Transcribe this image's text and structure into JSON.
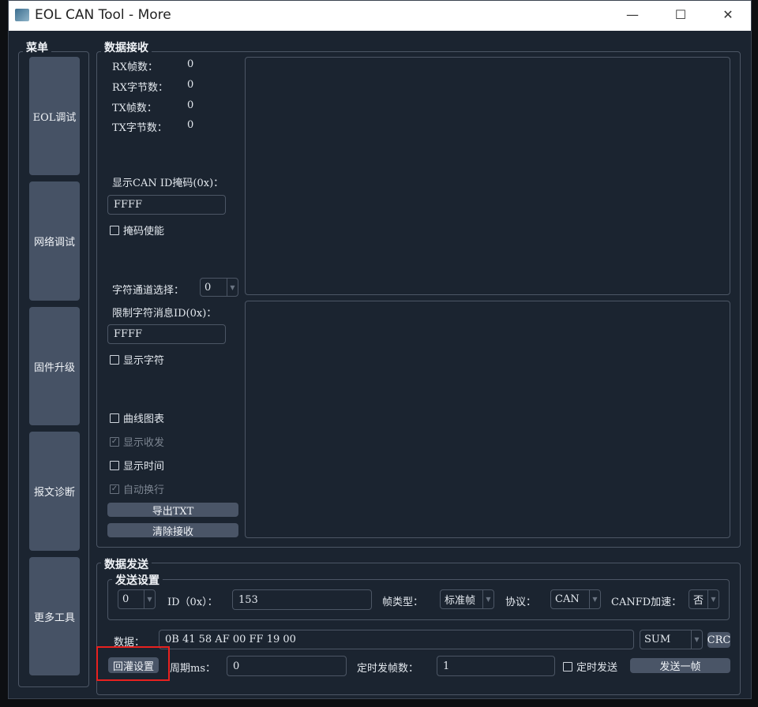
{
  "window": {
    "title": "EOL CAN Tool - More",
    "minimize": "—",
    "maximize": "☐",
    "close": "✕"
  },
  "menu": {
    "title": "菜单",
    "items": [
      "EOL调试",
      "网络调试",
      "固件升级",
      "报文诊断",
      "更多工具"
    ]
  },
  "receive": {
    "title": "数据接收",
    "stats": [
      {
        "label": "RX帧数：",
        "value": "0"
      },
      {
        "label": "RX字节数：",
        "value": "0"
      },
      {
        "label": "TX帧数：",
        "value": "0"
      },
      {
        "label": "TX字节数：",
        "value": "0"
      }
    ],
    "mask_label": "显示CAN ID掩码(0x)：",
    "mask_value": "FFFF",
    "mask_enable": "掩码使能",
    "channel_label": "字符通道选择：",
    "channel_value": "0",
    "limit_label": "限制字符消息ID(0x)：",
    "limit_value": "FFFF",
    "show_char": "显示字符",
    "curve_chart": "曲线图表",
    "show_txrx": "显示收发",
    "show_time": "显示时间",
    "auto_wrap": "自动换行",
    "export_txt": "导出TXT",
    "clear_receive": "清除接收"
  },
  "send": {
    "title": "数据发送",
    "settings_title": "发送设置",
    "channel_value": "0",
    "id_label": "ID（0x）：",
    "id_value": "153",
    "frame_type_label": "帧类型：",
    "frame_type_value": "标准帧",
    "protocol_label": "协议：",
    "protocol_value": "CAN",
    "canfd_label": "CANFD加速：",
    "canfd_value": "否",
    "data_label": "数据：",
    "data_value": "0B 41 58 AF 00 FF 19 00",
    "checksum_value": "SUM",
    "crc_label": "CRC",
    "replay_settings": "回灌设置",
    "period_label": "周期ms：",
    "period_value": "0",
    "timed_count_label": "定时发帧数：",
    "timed_count_value": "1",
    "timed_send": "定时发送",
    "send_one": "发送一帧"
  },
  "colors": {
    "background": "#1b2430",
    "button": "#465265",
    "highlight": "#e8211f"
  }
}
